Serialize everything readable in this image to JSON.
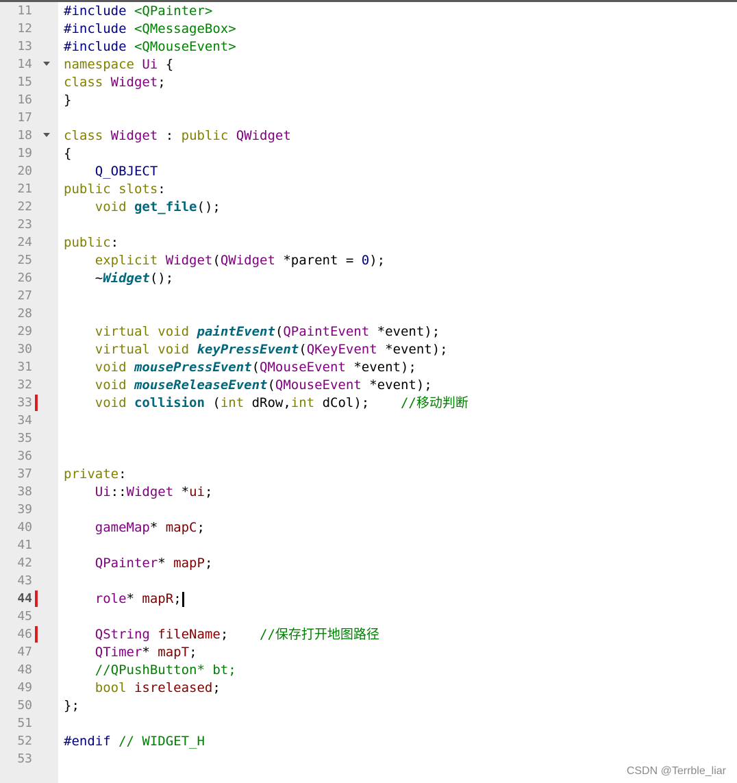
{
  "editor": {
    "lines": [
      {
        "n": "11",
        "tokens": [
          [
            "mac",
            "#include"
          ],
          [
            "",
            "<sp>"
          ],
          [
            "str",
            "<QPainter>"
          ]
        ]
      },
      {
        "n": "12",
        "tokens": [
          [
            "mac",
            "#include"
          ],
          [
            "",
            "<sp>"
          ],
          [
            "str",
            "<QMessageBox>"
          ]
        ]
      },
      {
        "n": "13",
        "tokens": [
          [
            "mac",
            "#include"
          ],
          [
            "",
            "<sp>"
          ],
          [
            "str",
            "<QMouseEvent>"
          ]
        ]
      },
      {
        "n": "14",
        "fold": true,
        "tokens": [
          [
            "kw",
            "namespace"
          ],
          [
            "",
            "<sp>"
          ],
          [
            "ty",
            "Ui"
          ],
          [
            "",
            ""
          ],
          [
            "",
            "<sp>{"
          ]
        ]
      },
      {
        "n": "15",
        "tokens": [
          [
            "kw",
            "class"
          ],
          [
            "",
            "<sp>"
          ],
          [
            "ty",
            "Widget"
          ],
          [
            "",
            ";"
          ]
        ]
      },
      {
        "n": "16",
        "tokens": [
          [
            "",
            "}"
          ]
        ]
      },
      {
        "n": "17",
        "tokens": []
      },
      {
        "n": "18",
        "fold": true,
        "tokens": [
          [
            "kw",
            "class"
          ],
          [
            "",
            "<sp>"
          ],
          [
            "ty",
            "Widget"
          ],
          [
            "",
            "<sp>:<sp>"
          ],
          [
            "kw",
            "public"
          ],
          [
            "",
            "<sp>"
          ],
          [
            "ty",
            "QWidget"
          ]
        ]
      },
      {
        "n": "19",
        "tokens": [
          [
            "",
            "{"
          ]
        ]
      },
      {
        "n": "20",
        "tokens": [
          [
            "",
            "<sp><sp><sp><sp>"
          ],
          [
            "mac",
            "Q_OBJECT"
          ]
        ]
      },
      {
        "n": "21",
        "tokens": [
          [
            "kw",
            "public"
          ],
          [
            "",
            "<sp>"
          ],
          [
            "kw",
            "slots"
          ],
          [
            "",
            ":"
          ]
        ]
      },
      {
        "n": "22",
        "tokens": [
          [
            "",
            "<sp><sp><sp><sp>"
          ],
          [
            "kw",
            "void"
          ],
          [
            "",
            "<sp>"
          ],
          [
            "fn",
            "get_file"
          ],
          [
            "",
            "();"
          ]
        ]
      },
      {
        "n": "23",
        "tokens": []
      },
      {
        "n": "24",
        "tokens": [
          [
            "kw",
            "public"
          ],
          [
            "",
            ":"
          ]
        ]
      },
      {
        "n": "25",
        "tokens": [
          [
            "",
            "<sp><sp><sp><sp>"
          ],
          [
            "kw",
            "explicit"
          ],
          [
            "",
            "<sp>"
          ],
          [
            "ty",
            "Widget"
          ],
          [
            "",
            "("
          ],
          [
            "ty",
            "QWidget"
          ],
          [
            "",
            "<sp>*parent<sp>=<sp>"
          ],
          [
            "num",
            "0"
          ],
          [
            "",
            ");"
          ]
        ]
      },
      {
        "n": "26",
        "tokens": [
          [
            "",
            "<sp><sp><sp><sp>~"
          ],
          [
            "fni",
            "Widget"
          ],
          [
            "",
            "();"
          ]
        ]
      },
      {
        "n": "27",
        "tokens": []
      },
      {
        "n": "28",
        "tokens": []
      },
      {
        "n": "29",
        "tokens": [
          [
            "",
            "<sp><sp><sp><sp>"
          ],
          [
            "kw",
            "virtual"
          ],
          [
            "",
            "<sp>"
          ],
          [
            "kw",
            "void"
          ],
          [
            "",
            "<sp>"
          ],
          [
            "fni",
            "paintEvent"
          ],
          [
            "",
            "("
          ],
          [
            "ty",
            "QPaintEvent"
          ],
          [
            "",
            "<sp>*event);"
          ]
        ]
      },
      {
        "n": "30",
        "tokens": [
          [
            "",
            "<sp><sp><sp><sp>"
          ],
          [
            "kw",
            "virtual"
          ],
          [
            "",
            "<sp>"
          ],
          [
            "kw",
            "void"
          ],
          [
            "",
            "<sp>"
          ],
          [
            "fni",
            "keyPressEvent"
          ],
          [
            "",
            "("
          ],
          [
            "ty",
            "QKeyEvent"
          ],
          [
            "",
            "<sp>*event);"
          ]
        ]
      },
      {
        "n": "31",
        "tokens": [
          [
            "",
            "<sp><sp><sp><sp>"
          ],
          [
            "kw",
            "void"
          ],
          [
            "",
            "<sp>"
          ],
          [
            "fni",
            "mousePressEvent"
          ],
          [
            "",
            "("
          ],
          [
            "ty",
            "QMouseEvent"
          ],
          [
            "",
            "<sp>*event);"
          ]
        ]
      },
      {
        "n": "32",
        "tokens": [
          [
            "",
            "<sp><sp><sp><sp>"
          ],
          [
            "kw",
            "void"
          ],
          [
            "",
            "<sp>"
          ],
          [
            "fni",
            "mouseReleaseEvent"
          ],
          [
            "",
            "("
          ],
          [
            "ty",
            "QMouseEvent"
          ],
          [
            "",
            "<sp>*event);"
          ]
        ]
      },
      {
        "n": "33",
        "marker": true,
        "tokens": [
          [
            "",
            "<sp><sp><sp><sp>"
          ],
          [
            "kw",
            "void"
          ],
          [
            "",
            "<sp>"
          ],
          [
            "fn",
            "collision"
          ],
          [
            "",
            "<sp>("
          ],
          [
            "kw",
            "int"
          ],
          [
            "",
            "<sp>dRow,"
          ],
          [
            "kw",
            "int"
          ],
          [
            "",
            "<sp>dCol);<sp><sp><sp><sp>"
          ],
          [
            "cm",
            "//移动判断"
          ]
        ]
      },
      {
        "n": "34",
        "tokens": []
      },
      {
        "n": "35",
        "tokens": []
      },
      {
        "n": "36",
        "tokens": []
      },
      {
        "n": "37",
        "tokens": [
          [
            "kw",
            "private"
          ],
          [
            "",
            ":"
          ]
        ]
      },
      {
        "n": "38",
        "tokens": [
          [
            "",
            "<sp><sp><sp><sp>"
          ],
          [
            "ty",
            "Ui"
          ],
          [
            "",
            "::"
          ],
          [
            "ty",
            "Widget"
          ],
          [
            "",
            "<sp>*"
          ],
          [
            "var",
            "ui"
          ],
          [
            "",
            ";"
          ]
        ]
      },
      {
        "n": "39",
        "tokens": []
      },
      {
        "n": "40",
        "tokens": [
          [
            "",
            "<sp><sp><sp><sp>"
          ],
          [
            "ty",
            "gameMap"
          ],
          [
            "",
            "*<sp>"
          ],
          [
            "var",
            "mapC"
          ],
          [
            "",
            ";"
          ]
        ]
      },
      {
        "n": "41",
        "tokens": []
      },
      {
        "n": "42",
        "tokens": [
          [
            "",
            "<sp><sp><sp><sp>"
          ],
          [
            "ty",
            "QPainter"
          ],
          [
            "",
            "*<sp>"
          ],
          [
            "var",
            "mapP"
          ],
          [
            "",
            ";"
          ]
        ]
      },
      {
        "n": "43",
        "tokens": []
      },
      {
        "n": "44",
        "marker": true,
        "current": true,
        "caret": true,
        "tokens": [
          [
            "",
            "<sp><sp><sp><sp>"
          ],
          [
            "ty",
            "role"
          ],
          [
            "",
            "*<sp>"
          ],
          [
            "var",
            "mapR"
          ],
          [
            "",
            ";"
          ]
        ]
      },
      {
        "n": "45",
        "tokens": []
      },
      {
        "n": "46",
        "marker": true,
        "tokens": [
          [
            "",
            "<sp><sp><sp><sp>"
          ],
          [
            "ty",
            "QString"
          ],
          [
            "",
            "<sp>"
          ],
          [
            "var",
            "fileName"
          ],
          [
            "",
            ";<sp><sp><sp><sp>"
          ],
          [
            "cm",
            "//保存打开地图路径"
          ]
        ]
      },
      {
        "n": "47",
        "tokens": [
          [
            "",
            "<sp><sp><sp><sp>"
          ],
          [
            "ty",
            "QTimer"
          ],
          [
            "",
            "*<sp>"
          ],
          [
            "var",
            "mapT"
          ],
          [
            "",
            ";"
          ]
        ]
      },
      {
        "n": "48",
        "tokens": [
          [
            "",
            "<sp><sp><sp><sp>"
          ],
          [
            "cm",
            "//QPushButton*<sp>bt;"
          ]
        ]
      },
      {
        "n": "49",
        "tokens": [
          [
            "",
            "<sp><sp><sp><sp>"
          ],
          [
            "kw",
            "bool"
          ],
          [
            "",
            "<sp>"
          ],
          [
            "var",
            "isreleased"
          ],
          [
            "",
            ";"
          ]
        ]
      },
      {
        "n": "50",
        "tokens": [
          [
            "",
            "};"
          ]
        ]
      },
      {
        "n": "51",
        "tokens": []
      },
      {
        "n": "52",
        "tokens": [
          [
            "mac",
            "#endif"
          ],
          [
            "",
            "<sp>"
          ],
          [
            "cm",
            "//<sp>WIDGET_H"
          ]
        ]
      },
      {
        "n": "53",
        "tokens": []
      }
    ]
  },
  "watermark": "CSDN @Terrble_liar"
}
